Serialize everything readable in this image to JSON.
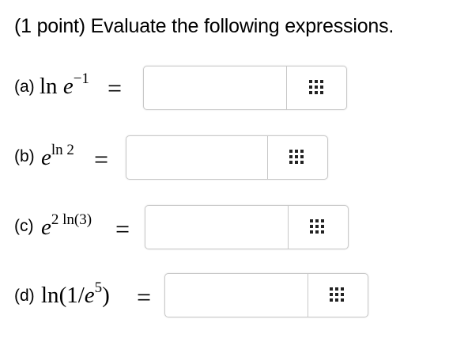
{
  "title": "(1 point) Evaluate the following expressions.",
  "equals": "=",
  "problems": [
    {
      "label": "(a)",
      "input_value": "",
      "tool_icon": "grid-icon"
    },
    {
      "label": "(b)",
      "input_value": "",
      "tool_icon": "grid-icon"
    },
    {
      "label": "(c)",
      "input_value": "",
      "tool_icon": "grid-icon"
    },
    {
      "label": "(d)",
      "input_value": "",
      "tool_icon": "grid-icon"
    }
  ],
  "math": {
    "a": {
      "fn": "ln",
      "base": "e",
      "exp": "−1"
    },
    "b": {
      "base": "e",
      "exp": "ln 2"
    },
    "c": {
      "base": "e",
      "exp": "2 ln(3)"
    },
    "d": {
      "fn": "ln",
      "open": "(1/",
      "base": "e",
      "exp": "5",
      "close": ")"
    }
  }
}
